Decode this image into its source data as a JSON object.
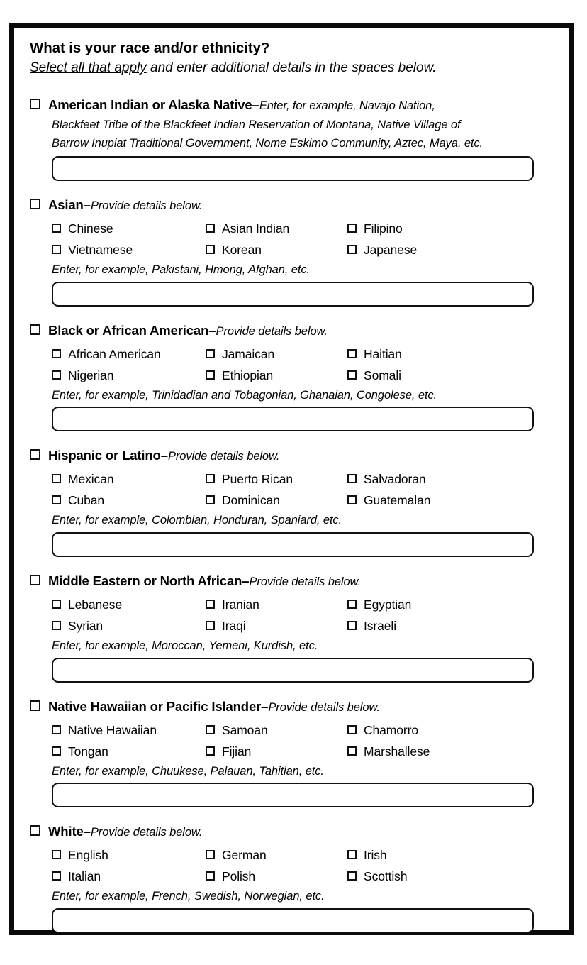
{
  "form": {
    "title": "What is your race and/or ethnicity?",
    "instruction_underlined": "Select all that apply",
    "instruction_rest": " and enter additional details in the spaces below.",
    "dash": "–",
    "sections": [
      {
        "id": "american-indian-alaska-native",
        "label": "American Indian or Alaska Native",
        "hint_inline": "Enter, for example, Navajo Nation,",
        "hint_lines": [
          "Blackfeet Tribe of the Blackfeet Indian Reservation of Montana, Native Village of",
          "Barrow Inupiat Traditional Government, Nome Eskimo Community, Aztec, Maya, etc."
        ],
        "options": [],
        "hint_below": "",
        "input_value": ""
      },
      {
        "id": "asian",
        "label": "Asian",
        "hint_inline": "Provide details below.",
        "hint_lines": [],
        "options": [
          "Chinese",
          "Asian Indian",
          "Filipino",
          "Vietnamese",
          "Korean",
          "Japanese"
        ],
        "hint_below": "Enter, for example, Pakistani, Hmong, Afghan, etc.",
        "input_value": ""
      },
      {
        "id": "black-or-african-american",
        "label": "Black or African American",
        "hint_inline": "Provide details below.",
        "hint_lines": [],
        "options": [
          "African American",
          "Jamaican",
          "Haitian",
          "Nigerian",
          "Ethiopian",
          "Somali"
        ],
        "hint_below": "Enter, for example, Trinidadian and Tobagonian, Ghanaian, Congolese, etc.",
        "input_value": ""
      },
      {
        "id": "hispanic-or-latino",
        "label": "Hispanic or Latino",
        "hint_inline": "Provide details below.",
        "hint_lines": [],
        "options": [
          "Mexican",
          "Puerto Rican",
          "Salvadoran",
          "Cuban",
          "Dominican",
          "Guatemalan"
        ],
        "hint_below": "Enter, for example, Colombian, Honduran, Spaniard, etc.",
        "input_value": ""
      },
      {
        "id": "middle-eastern-or-north-african",
        "label": "Middle Eastern or North African",
        "hint_inline": "Provide details below.",
        "hint_lines": [],
        "options": [
          "Lebanese",
          "Iranian",
          "Egyptian",
          "Syrian",
          "Iraqi",
          "Israeli"
        ],
        "hint_below": "Enter, for example, Moroccan, Yemeni, Kurdish, etc.",
        "input_value": ""
      },
      {
        "id": "native-hawaiian-or-pacific-islander",
        "label": "Native Hawaiian or Pacific Islander",
        "hint_inline": "Provide details below.",
        "hint_lines": [],
        "options": [
          "Native Hawaiian",
          "Samoan",
          "Chamorro",
          "Tongan",
          "Fijian",
          "Marshallese"
        ],
        "hint_below": "Enter, for example, Chuukese, Palauan, Tahitian, etc.",
        "input_value": ""
      },
      {
        "id": "white",
        "label": "White",
        "hint_inline": "Provide details below.",
        "hint_lines": [],
        "options": [
          "English",
          "German",
          "Irish",
          "Italian",
          "Polish",
          "Scottish"
        ],
        "hint_below": "Enter, for example, French, Swedish, Norwegian, etc.",
        "input_value": ""
      }
    ]
  },
  "colors": {
    "frame": "#0a0a0a",
    "text": "#000000",
    "box_border": "#111111",
    "background": "#ffffff"
  }
}
